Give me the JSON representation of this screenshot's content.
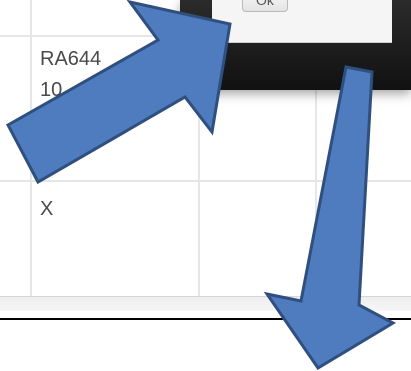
{
  "grid": {
    "cells": [
      {
        "text": "RA644"
      },
      {
        "text": "10"
      },
      {
        "text": "X"
      }
    ]
  },
  "dialog": {
    "ok_label": "Ok"
  },
  "annotations": {
    "arrow_color": "#4f7bbf",
    "arrow_outline": "#2f4f7f"
  }
}
